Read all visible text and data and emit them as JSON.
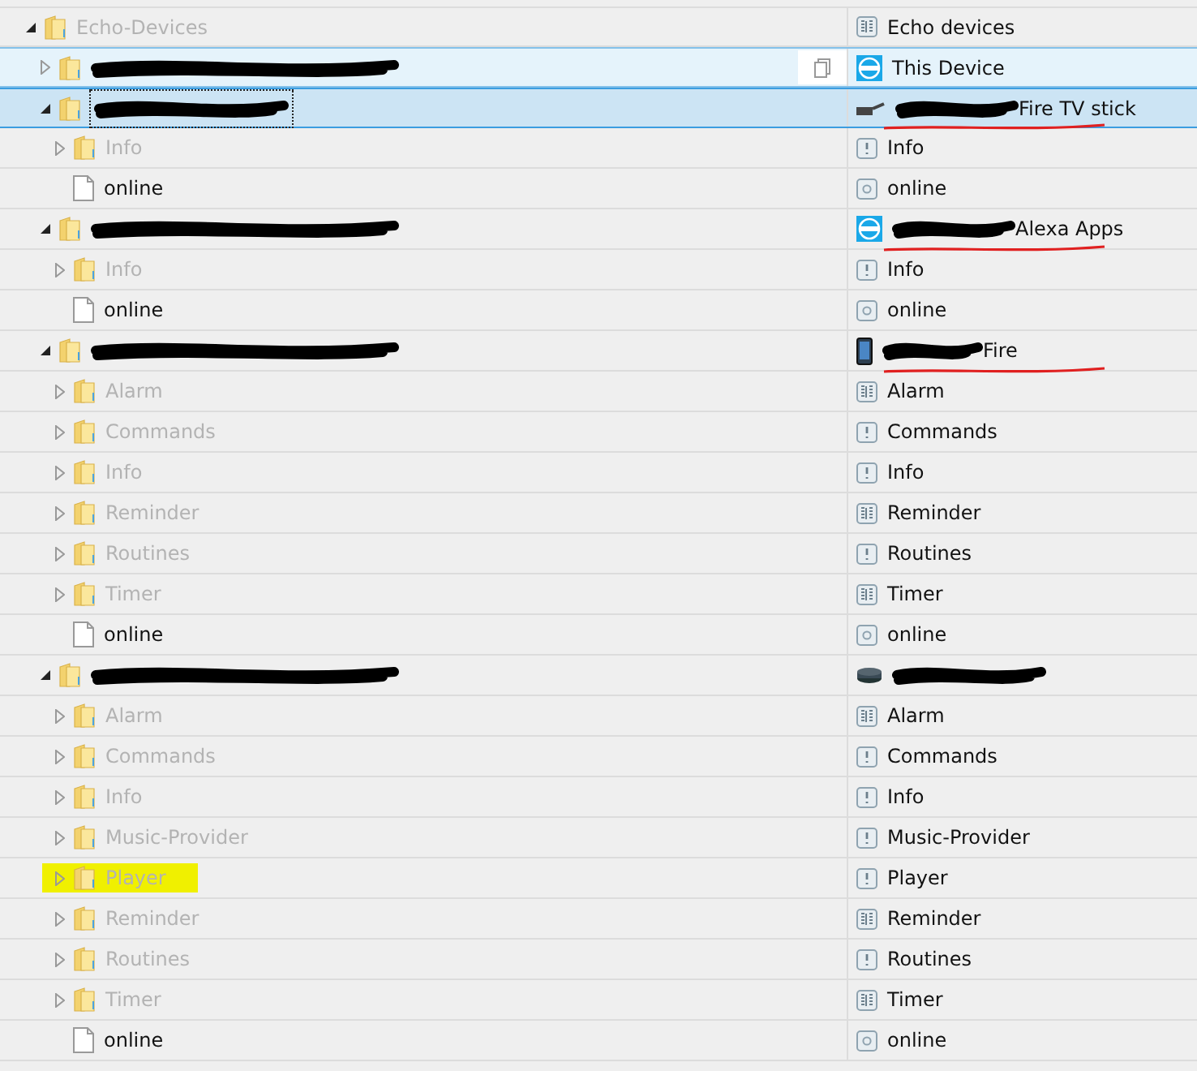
{
  "tree": [
    {
      "name": "Echo-Devices",
      "kind": "folder",
      "expanded": true,
      "selected": false,
      "hovered": false,
      "object": {
        "kind": "channel",
        "name": "Echo devices"
      },
      "children": [
        {
          "kind": "folder",
          "expanded": false,
          "selected": false,
          "hovered": true,
          "redacted": true,
          "object": {
            "kind": "apps",
            "name": "This Device"
          }
        },
        {
          "kind": "folder",
          "expanded": true,
          "selected": true,
          "hovered": false,
          "redacted": true,
          "object": {
            "kind": "stick",
            "redacted": true,
            "name": "Fire TV stick",
            "underlined": true
          },
          "children": [
            {
              "name": "Info",
              "kind": "folder",
              "expanded": false,
              "selected": false,
              "hovered": false,
              "object": {
                "kind": "group",
                "name": "Info"
              }
            },
            {
              "name": "online",
              "kind": "state",
              "selected": false,
              "hovered": false,
              "object": {
                "kind": "state",
                "name": "online"
              }
            }
          ]
        },
        {
          "kind": "folder",
          "expanded": true,
          "selected": false,
          "hovered": false,
          "redacted": true,
          "object": {
            "kind": "apps",
            "redacted": true,
            "name": "Alexa Apps",
            "underlined": true
          },
          "children": [
            {
              "name": "Info",
              "kind": "folder",
              "expanded": false,
              "selected": false,
              "hovered": false,
              "object": {
                "kind": "group",
                "name": "Info"
              }
            },
            {
              "name": "online",
              "kind": "state",
              "selected": false,
              "hovered": false,
              "object": {
                "kind": "state",
                "name": "online"
              }
            }
          ]
        },
        {
          "kind": "folder",
          "expanded": true,
          "selected": false,
          "hovered": false,
          "redacted": true,
          "object": {
            "kind": "phone",
            "redacted": true,
            "name": "Fire",
            "underlined": true
          },
          "children": [
            {
              "name": "Alarm",
              "kind": "folder",
              "expanded": false,
              "selected": false,
              "hovered": false,
              "object": {
                "kind": "channel",
                "name": "Alarm"
              }
            },
            {
              "name": "Commands",
              "kind": "folder",
              "expanded": false,
              "selected": false,
              "hovered": false,
              "object": {
                "kind": "group",
                "name": "Commands"
              }
            },
            {
              "name": "Info",
              "kind": "folder",
              "expanded": false,
              "selected": false,
              "hovered": false,
              "object": {
                "kind": "group",
                "name": "Info"
              }
            },
            {
              "name": "Reminder",
              "kind": "folder",
              "expanded": false,
              "selected": false,
              "hovered": false,
              "object": {
                "kind": "channel",
                "name": "Reminder"
              }
            },
            {
              "name": "Routines",
              "kind": "folder",
              "expanded": false,
              "selected": false,
              "hovered": false,
              "object": {
                "kind": "group",
                "name": "Routines"
              }
            },
            {
              "name": "Timer",
              "kind": "folder",
              "expanded": false,
              "selected": false,
              "hovered": false,
              "object": {
                "kind": "channel",
                "name": "Timer"
              }
            },
            {
              "name": "online",
              "kind": "state",
              "selected": false,
              "hovered": false,
              "object": {
                "kind": "state",
                "name": "online"
              }
            }
          ]
        },
        {
          "kind": "folder",
          "expanded": true,
          "selected": false,
          "hovered": false,
          "redacted": true,
          "object": {
            "kind": "dot",
            "redacted": true
          },
          "children": [
            {
              "name": "Alarm",
              "kind": "folder",
              "expanded": false,
              "selected": false,
              "hovered": false,
              "object": {
                "kind": "channel",
                "name": "Alarm"
              }
            },
            {
              "name": "Commands",
              "kind": "folder",
              "expanded": false,
              "selected": false,
              "hovered": false,
              "object": {
                "kind": "group",
                "name": "Commands"
              }
            },
            {
              "name": "Info",
              "kind": "folder",
              "expanded": false,
              "selected": false,
              "hovered": false,
              "object": {
                "kind": "group",
                "name": "Info"
              }
            },
            {
              "name": "Music-Provider",
              "kind": "folder",
              "expanded": false,
              "selected": false,
              "hovered": false,
              "object": {
                "kind": "group",
                "name": "Music-Provider"
              }
            },
            {
              "name": "Player",
              "kind": "folder",
              "expanded": false,
              "selected": false,
              "hovered": false,
              "highlighted": true,
              "object": {
                "kind": "group",
                "name": "Player"
              }
            },
            {
              "name": "Reminder",
              "kind": "folder",
              "expanded": false,
              "selected": false,
              "hovered": false,
              "object": {
                "kind": "channel",
                "name": "Reminder"
              }
            },
            {
              "name": "Routines",
              "kind": "folder",
              "expanded": false,
              "selected": false,
              "hovered": false,
              "object": {
                "kind": "group",
                "name": "Routines"
              }
            },
            {
              "name": "Timer",
              "kind": "folder",
              "expanded": false,
              "selected": false,
              "hovered": false,
              "object": {
                "kind": "channel",
                "name": "Timer"
              }
            },
            {
              "name": "online",
              "kind": "state",
              "selected": false,
              "hovered": false,
              "object": {
                "kind": "state",
                "name": "online"
              }
            }
          ]
        }
      ]
    }
  ]
}
